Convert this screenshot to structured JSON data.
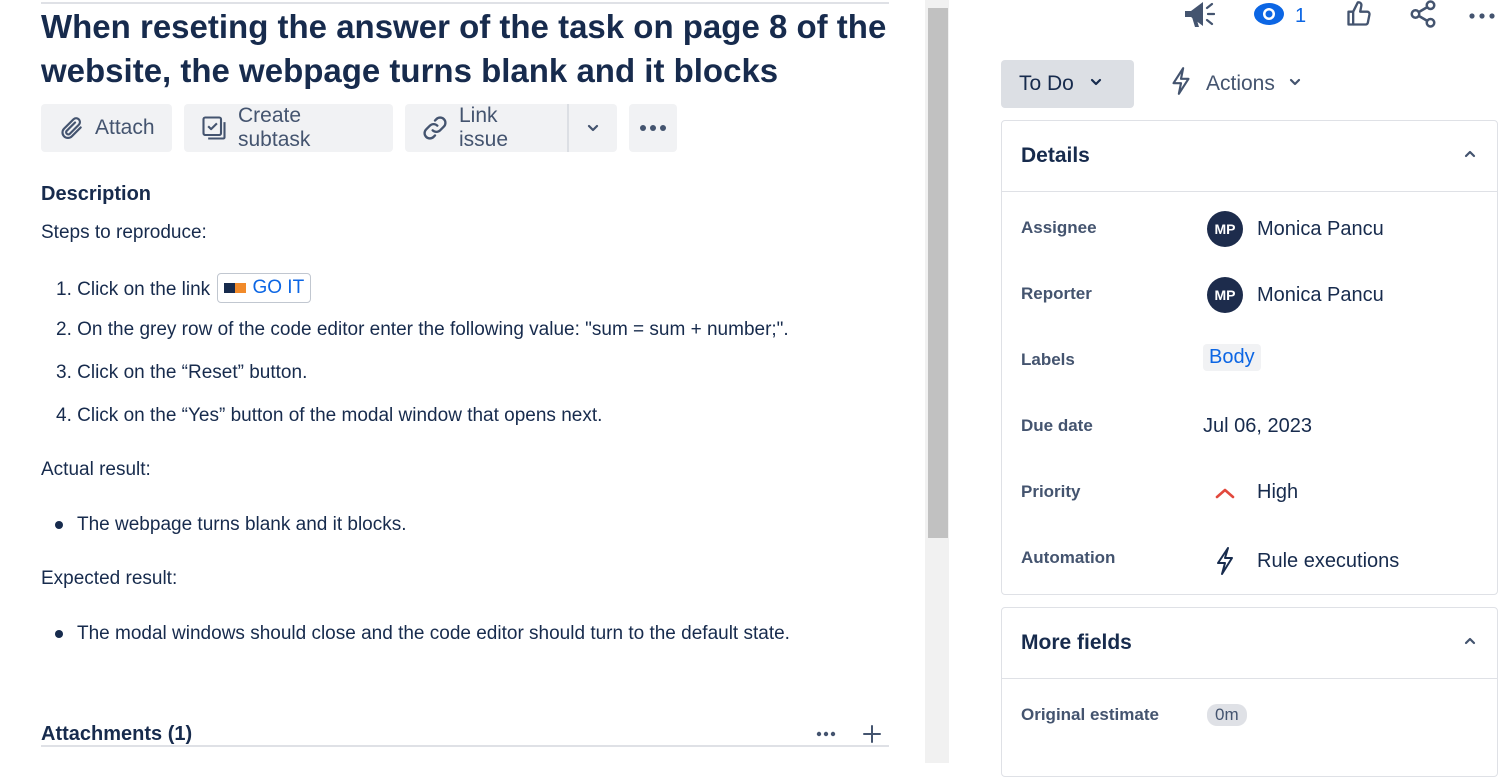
{
  "issue": {
    "title": "When reseting the answer of the task on page 8 of the website, the webpage turns blank and it blocks"
  },
  "toolbar": {
    "attach_label": "Attach",
    "create_subtask_label": "Create subtask",
    "link_issue_label": "Link issue"
  },
  "description": {
    "heading": "Description",
    "intro": "Steps to reproduce:",
    "steps": [
      "1.  Click on the link",
      "2. On the grey row of the code editor enter the following value: \"sum = sum + number;\".",
      "3. Click on the “Reset” button.",
      "4. Click on the “Yes” button of the modal window that opens next."
    ],
    "link_text": "GO IT",
    "actual_heading": "Actual result:",
    "actual_items": [
      "The webpage turns blank and it blocks."
    ],
    "expected_heading": "Expected result:",
    "expected_items": [
      "The modal windows should close and the code editor should turn to the default state."
    ]
  },
  "attachments": {
    "heading": "Attachments (1)"
  },
  "header_actions": {
    "watch_count": "1"
  },
  "status": {
    "label": "To Do",
    "actions_label": "Actions"
  },
  "details": {
    "heading": "Details",
    "fields": [
      {
        "label": "Assignee",
        "value": "Monica Pancu",
        "initials": "MP"
      },
      {
        "label": "Reporter",
        "value": "Monica Pancu",
        "initials": "MP"
      },
      {
        "label": "Labels",
        "value": "Body"
      },
      {
        "label": "Due date",
        "value": "Jul 06, 2023"
      },
      {
        "label": "Priority",
        "value": "High"
      },
      {
        "label": "Automation",
        "value": "Rule executions"
      }
    ]
  },
  "more_fields": {
    "heading": "More fields",
    "fields": [
      {
        "label": "Original estimate",
        "value": "0m"
      }
    ]
  },
  "colors": {
    "accent": "#0c66e4",
    "priority_high": "#e2483d",
    "avatar_bg": "#1d2c4c"
  }
}
